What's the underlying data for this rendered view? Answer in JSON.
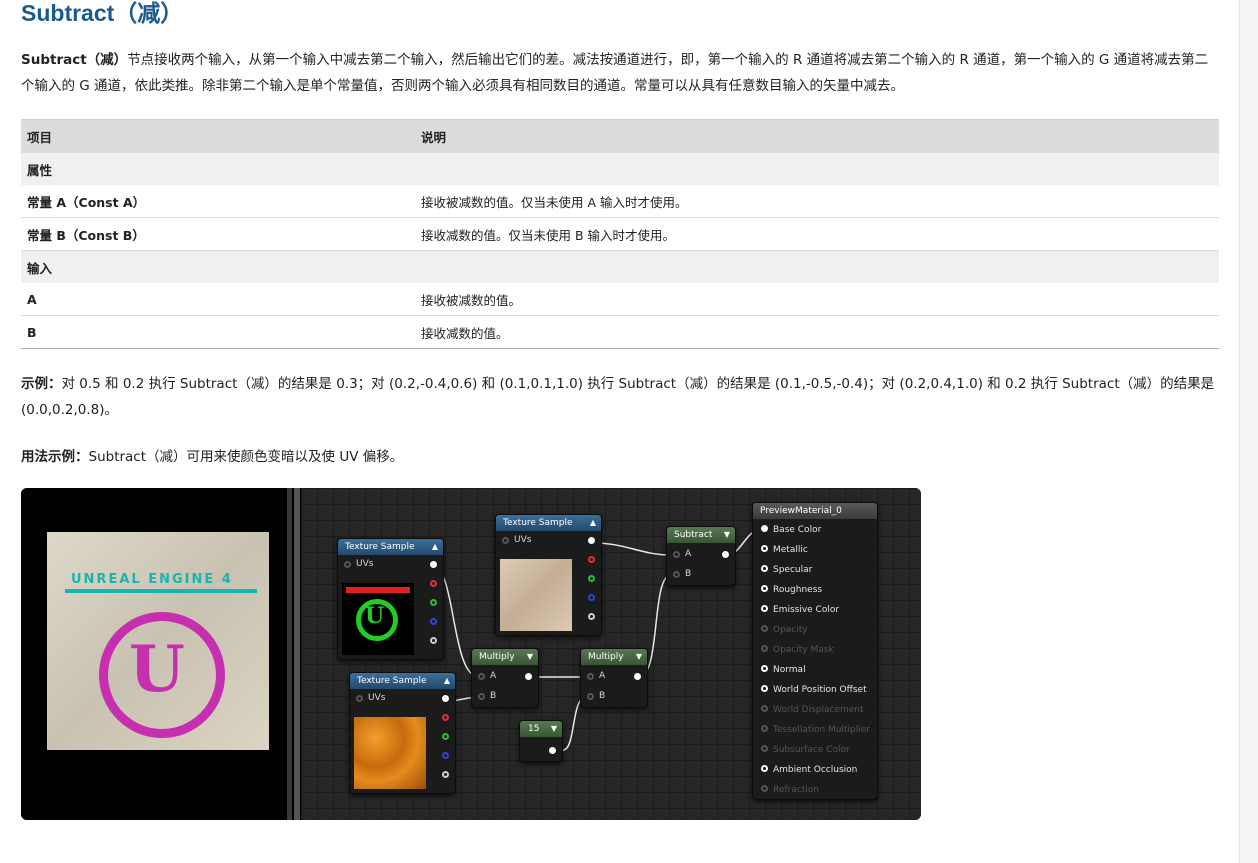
{
  "title": "Subtract（减）",
  "intro": {
    "bold": "Subtract（减）",
    "text": "节点接收两个输入，从第一个输入中减去第二个输入，然后输出它们的差。减法按通道进行，即，第一个输入的 R 通道将减去第二个输入的 R 通道，第一个输入的 G 通道将减去第二个输入的 G 通道，依此类推。除非第二个输入是单个常量值，否则两个输入必须具有相同数目的通道。常量可以从具有任意数目输入的矢量中减去。"
  },
  "table": {
    "headers": [
      "项目",
      "说明"
    ],
    "rows": [
      {
        "type": "section",
        "item": "属性",
        "desc": ""
      },
      {
        "type": "row",
        "item": "常量 A（Const A）",
        "desc": "接收被减数的值。仅当未使用 A 输入时才使用。"
      },
      {
        "type": "row",
        "item": "常量 B（Const B）",
        "desc": "接收减数的值。仅当未使用 B 输入时才使用。"
      },
      {
        "type": "section",
        "item": "输入",
        "desc": ""
      },
      {
        "type": "row",
        "item": "A",
        "desc": "接收被减数的值。"
      },
      {
        "type": "row",
        "item": "B",
        "desc": "接收减数的值。"
      }
    ]
  },
  "example": {
    "label": "示例：",
    "text": "对 0.5 和 0.2 执行 Subtract（减）的结果是 0.3；对 (0.2,-0.4,0.6) 和 (0.1,0.1,1.0) 执行 Subtract（减）的结果是 (0.1,-0.5,-0.4)；对 (0.2,0.4,1.0) 和 0.2 执行 Subtract（减）的结果是 (0.0,0.2,0.8)。"
  },
  "usage": {
    "label": "用法示例：",
    "text": "Subtract（减）可用来使颜色变暗以及使 UV 偏移。"
  },
  "figure": {
    "preview_text": "UNREAL ENGINE 4",
    "preview_logo": "U",
    "node_tex1": {
      "title": "Texture Sample",
      "uvs": "UVs"
    },
    "node_tex2": {
      "title": "Texture Sample",
      "uvs": "UVs"
    },
    "node_tex3": {
      "title": "Texture Sample",
      "uvs": "UVs"
    },
    "node_mul1": {
      "title": "Multiply",
      "a": "A",
      "b": "B"
    },
    "node_mul2": {
      "title": "Multiply",
      "a": "A",
      "b": "B"
    },
    "node_sub": {
      "title": "Subtract",
      "a": "A",
      "b": "B"
    },
    "node_const": {
      "value": "15"
    },
    "node_mat": {
      "title": "PreviewMaterial_0",
      "inputs": [
        {
          "label": "Base Color",
          "active": true
        },
        {
          "label": "Metallic",
          "active": true
        },
        {
          "label": "Specular",
          "active": true
        },
        {
          "label": "Roughness",
          "active": true
        },
        {
          "label": "Emissive Color",
          "active": true
        },
        {
          "label": "Opacity",
          "active": false
        },
        {
          "label": "Opacity Mask",
          "active": false
        },
        {
          "label": "Normal",
          "active": true
        },
        {
          "label": "World Position Offset",
          "active": true
        },
        {
          "label": "World Displacement",
          "active": false
        },
        {
          "label": "Tessellation Multiplier",
          "active": false
        },
        {
          "label": "Subsurface Color",
          "active": false
        },
        {
          "label": "Ambient Occlusion",
          "active": true
        },
        {
          "label": "Refraction",
          "active": false
        }
      ]
    }
  }
}
